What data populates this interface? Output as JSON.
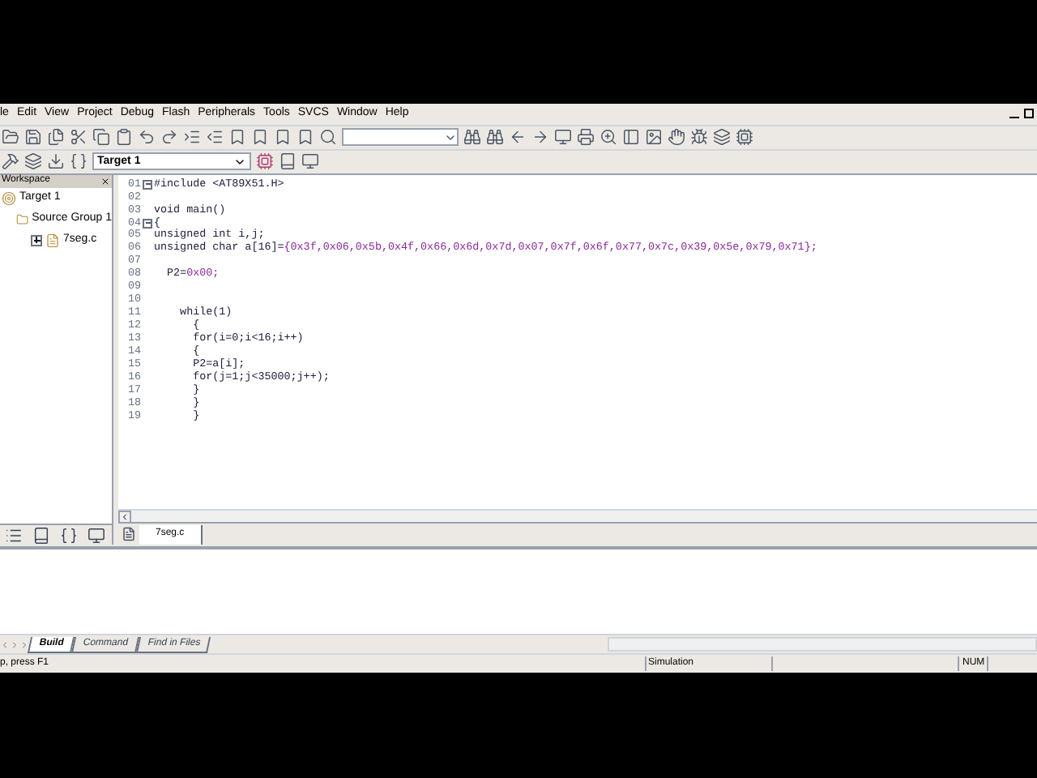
{
  "menu": [
    "le",
    "Edit",
    "View",
    "Project",
    "Debug",
    "Flash",
    "Peripherals",
    "Tools",
    "SVCS",
    "Window",
    "Help"
  ],
  "toolbar_target": {
    "value": "Target 1"
  },
  "workspace": {
    "title": "Workspace",
    "tree": [
      {
        "label": "Target 1",
        "kind": "target",
        "children": [
          {
            "label": "Source Group 1",
            "kind": "folder",
            "children": [
              {
                "label": "7seg.c",
                "kind": "file",
                "expanded": false
              }
            ]
          }
        ]
      }
    ]
  },
  "editor": {
    "lines": [
      {
        "number": "01",
        "fold": true,
        "parts": [
          {
            "text": "#include <AT89X51.H>",
            "kind": "text"
          }
        ]
      },
      {
        "number": "02"
      },
      {
        "number": "03",
        "parts": [
          {
            "text": "void main()",
            "kind": "text"
          }
        ]
      },
      {
        "number": "04",
        "fold": true,
        "parts": [
          {
            "text": "{",
            "kind": "text"
          }
        ]
      },
      {
        "number": "05",
        "parts": [
          {
            "text": "unsigned int i,j;",
            "kind": "text"
          }
        ]
      },
      {
        "number": "06",
        "parts": [
          {
            "text": "unsigned char a[16]=",
            "kind": "text"
          },
          {
            "text": "{0x3f,0x06,0x5b,0x4f,0x66,0x6d,0x7d,0x07,0x7f,0x6f,0x77,0x7c,0x39,0x5e,0x79,0x71};",
            "kind": "number"
          }
        ]
      },
      {
        "number": "07"
      },
      {
        "number": "08",
        "parts": [
          {
            "text": "  P2=",
            "kind": "text"
          },
          {
            "text": "0x00;",
            "kind": "number"
          }
        ]
      },
      {
        "number": "09"
      },
      {
        "number": "10"
      },
      {
        "number": "11",
        "parts": [
          {
            "text": "    while(1)",
            "kind": "text"
          }
        ]
      },
      {
        "number": "12",
        "parts": [
          {
            "text": "      {",
            "kind": "text"
          }
        ]
      },
      {
        "number": "13",
        "parts": [
          {
            "text": "      for(i=0;i<16;i++)",
            "kind": "text"
          }
        ]
      },
      {
        "number": "14",
        "parts": [
          {
            "text": "      {",
            "kind": "text"
          }
        ]
      },
      {
        "number": "15",
        "parts": [
          {
            "text": "      P2=a[i];",
            "kind": "text"
          }
        ]
      },
      {
        "number": "16",
        "parts": [
          {
            "text": "      for(j=1;j<35000;j++);",
            "kind": "text"
          }
        ]
      },
      {
        "number": "17",
        "parts": [
          {
            "text": "      }",
            "kind": "text"
          }
        ]
      },
      {
        "number": "18",
        "parts": [
          {
            "text": "      }",
            "kind": "text"
          }
        ]
      },
      {
        "number": "19",
        "parts": [
          {
            "text": "      }",
            "kind": "text"
          }
        ]
      }
    ],
    "file_tabs": [
      {
        "label": "7seg.c",
        "selected": true
      }
    ]
  },
  "output_tabs": [
    {
      "label": "Build",
      "selected": true
    },
    {
      "label": "Command",
      "selected": false
    },
    {
      "label": "Find in Files",
      "selected": false
    }
  ],
  "status_bar": {
    "help": "p, press F1",
    "mode": "Simulation",
    "num": "NUM"
  }
}
